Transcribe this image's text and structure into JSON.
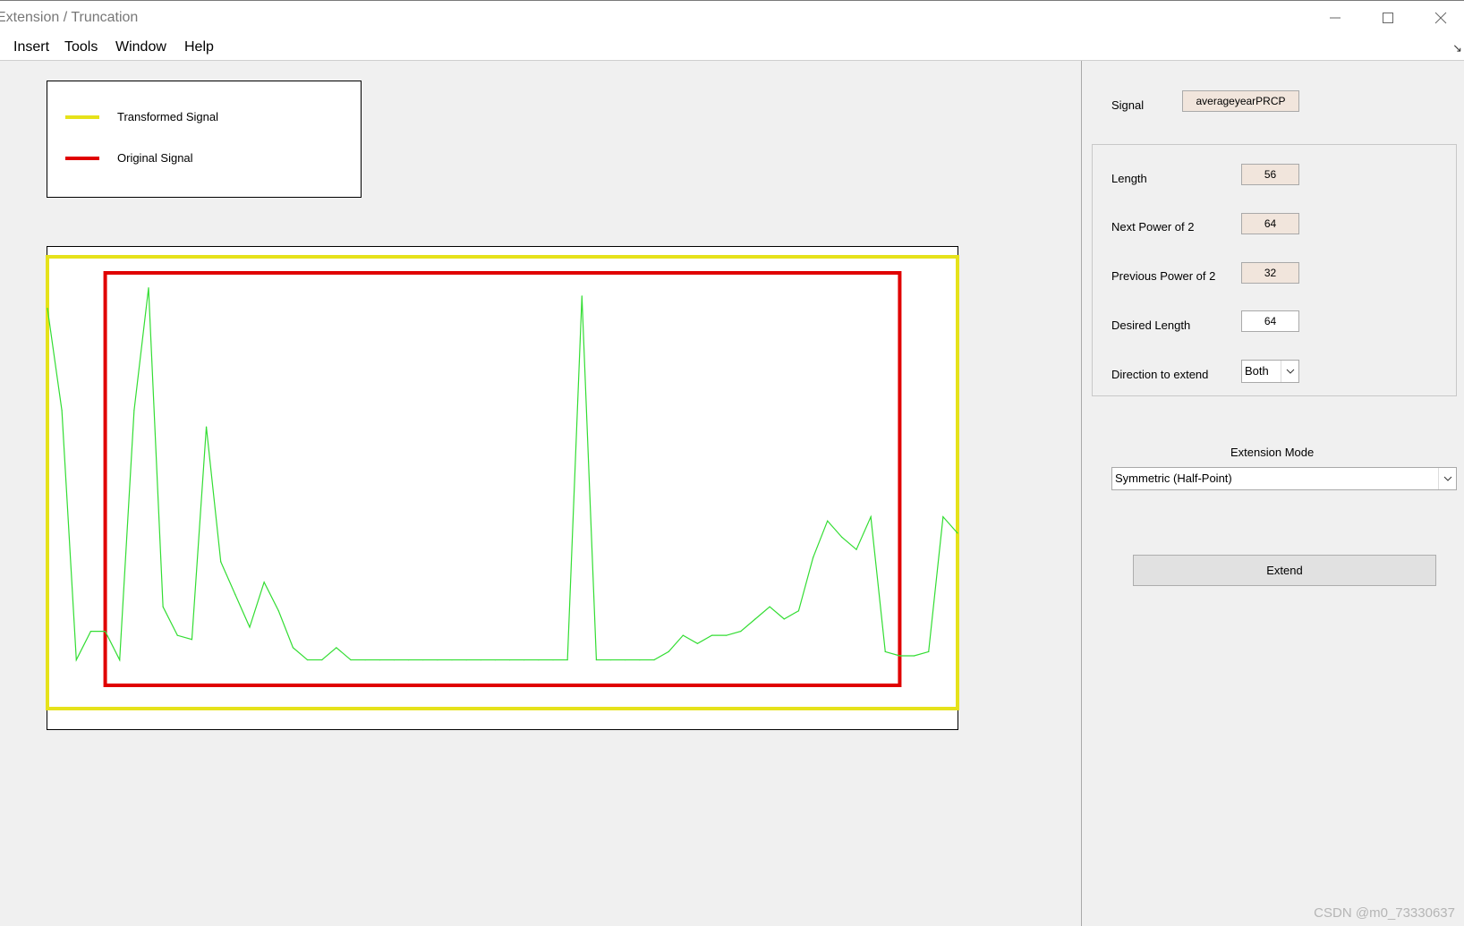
{
  "window": {
    "title": "Extension / Truncation",
    "controls": [
      "minimize-icon",
      "maximize-icon",
      "close-icon"
    ]
  },
  "menu": {
    "items": [
      "Insert",
      "Tools",
      "Window",
      "Help"
    ],
    "dock_glyph": "↘"
  },
  "legend": {
    "items": [
      {
        "label": "Transformed Signal",
        "color": "#e6e21a"
      },
      {
        "label": "Original Signal",
        "color": "#e00000"
      }
    ]
  },
  "chart_data": {
    "type": "line",
    "series": [
      {
        "color": "#33dd33",
        "values": [
          0.92,
          0.67,
          0.06,
          0.13,
          0.13,
          0.06,
          0.67,
          0.97,
          0.19,
          0.12,
          0.11,
          0.63,
          0.3,
          0.22,
          0.14,
          0.25,
          0.18,
          0.09,
          0.06,
          0.06,
          0.09,
          0.06,
          0.06,
          0.06,
          0.06,
          0.06,
          0.06,
          0.06,
          0.06,
          0.06,
          0.06,
          0.06,
          0.06,
          0.06,
          0.06,
          0.06,
          0.06,
          0.95,
          0.06,
          0.06,
          0.06,
          0.06,
          0.06,
          0.08,
          0.12,
          0.1,
          0.12,
          0.12,
          0.13,
          0.16,
          0.19,
          0.16,
          0.18,
          0.31,
          0.4,
          0.36,
          0.33,
          0.41,
          0.08,
          0.07,
          0.07,
          0.08,
          0.41,
          0.37
        ]
      }
    ],
    "xlim": [
      1,
      64
    ],
    "ylim": [
      0,
      1
    ],
    "transformed_extent": [
      1,
      64
    ],
    "original_extent": [
      5,
      60
    ],
    "grid": false
  },
  "panel": {
    "signal_label": "Signal",
    "signal_value": "averageyearPRCP",
    "length_label": "Length",
    "length_value": "56",
    "next_pow_label": "Next Power of 2",
    "next_pow_value": "64",
    "prev_pow_label": "Previous Power of 2",
    "prev_pow_value": "32",
    "desired_label": "Desired Length",
    "desired_value": "64",
    "direction_label": "Direction to extend",
    "direction_value": "Both",
    "mode_label": "Extension Mode",
    "mode_value": "Symmetric (Half-Point)",
    "extend_button": "Extend"
  },
  "watermark": "CSDN @m0_73330637"
}
